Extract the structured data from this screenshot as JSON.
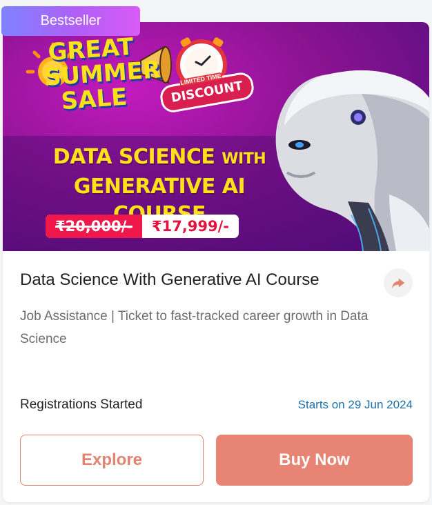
{
  "badge": {
    "label": "Bestseller"
  },
  "banner": {
    "sale_text": "GREAT SUMMER SALE",
    "discount_label": "DISCOUNT",
    "limited_label": "LIMITED TIME",
    "title_line1": "DATA SCIENCE",
    "title_with": "WITH",
    "title_line2": "GENERATIVE AI COURSE",
    "old_price": "₹20,000/-",
    "new_price": "₹17,999/-"
  },
  "course": {
    "title": "Data Science With Generative AI Course",
    "subtitle": "Job Assistance | Ticket to fast-tracked career growth in Data Science",
    "status": "Registrations Started",
    "start_date": "Starts on 29 Jun 2024"
  },
  "actions": {
    "explore_label": "Explore",
    "buy_label": "Buy Now"
  },
  "icons": {
    "share": "share-arrow-icon"
  },
  "colors": {
    "badge_gradient_start": "#7e83ff",
    "badge_gradient_end": "#d85cf6",
    "banner_bg": "#8b1392",
    "accent": "#e88474",
    "link_blue": "#1e6fa8",
    "price_red": "#f0174b",
    "title_yellow": "#ffe11a"
  }
}
